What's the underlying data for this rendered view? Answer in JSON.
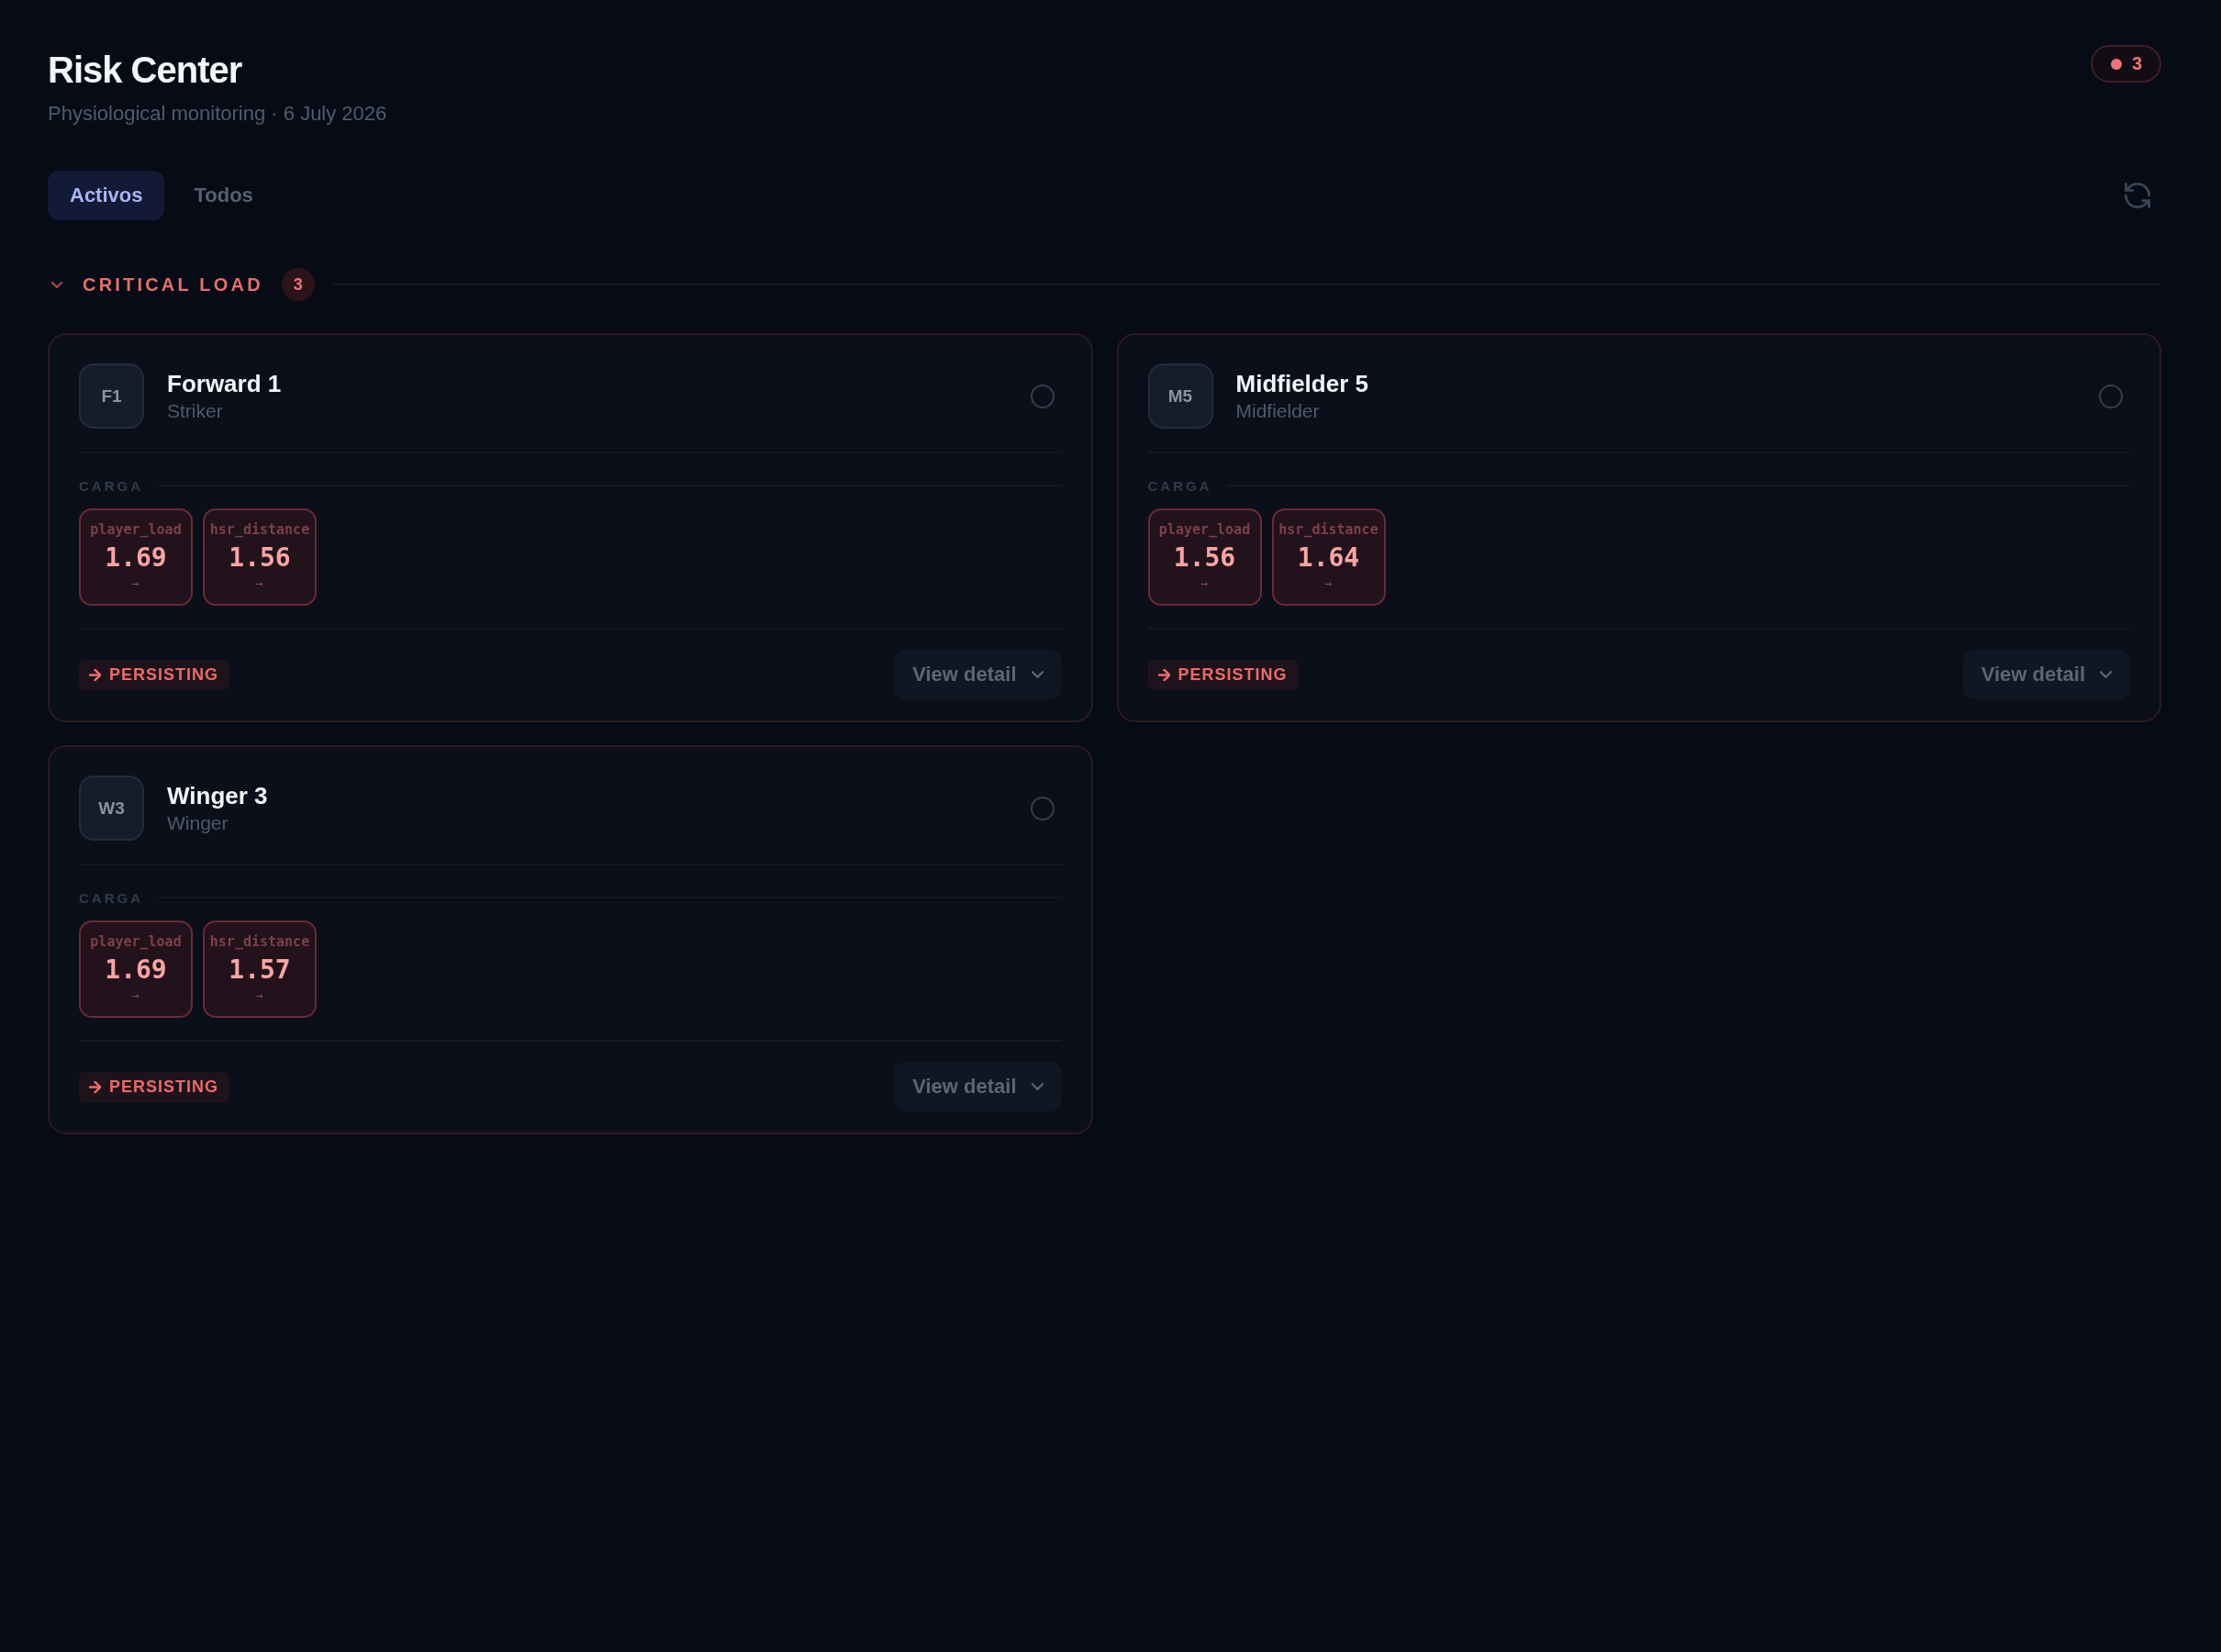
{
  "header": {
    "title": "Risk Center",
    "subtitle": "Physiological monitoring · 6 July 2026"
  },
  "alert_badge": {
    "count": "3"
  },
  "tabs": [
    {
      "label": "Activos",
      "selected": true
    },
    {
      "label": "Todos",
      "selected": false
    }
  ],
  "groups": [
    {
      "title": "CRITICAL LOAD",
      "count": "3",
      "expanded": true,
      "cards": [
        {
          "initials": "F1",
          "name": "Forward 1",
          "role": "Striker",
          "selected": false,
          "metrics_title": "CARGA",
          "metrics": [
            {
              "label": "player_load",
              "value": "1.69",
              "trend": "→"
            },
            {
              "label": "hsr_distance",
              "value": "1.56",
              "trend": "→"
            }
          ],
          "status": "PERSISTING",
          "action": "View detail"
        },
        {
          "initials": "M5",
          "name": "Midfielder 5",
          "role": "Midfielder",
          "selected": false,
          "metrics_title": "CARGA",
          "metrics": [
            {
              "label": "player_load",
              "value": "1.56",
              "trend": "→"
            },
            {
              "label": "hsr_distance",
              "value": "1.64",
              "trend": "→"
            }
          ],
          "status": "PERSISTING",
          "action": "View detail"
        },
        {
          "initials": "W3",
          "name": "Winger 3",
          "role": "Winger",
          "selected": false,
          "metrics_title": "CARGA",
          "metrics": [
            {
              "label": "player_load",
              "value": "1.69",
              "trend": "→"
            },
            {
              "label": "hsr_distance",
              "value": "1.57",
              "trend": "→"
            }
          ],
          "status": "PERSISTING",
          "action": "View detail"
        }
      ]
    }
  ]
}
